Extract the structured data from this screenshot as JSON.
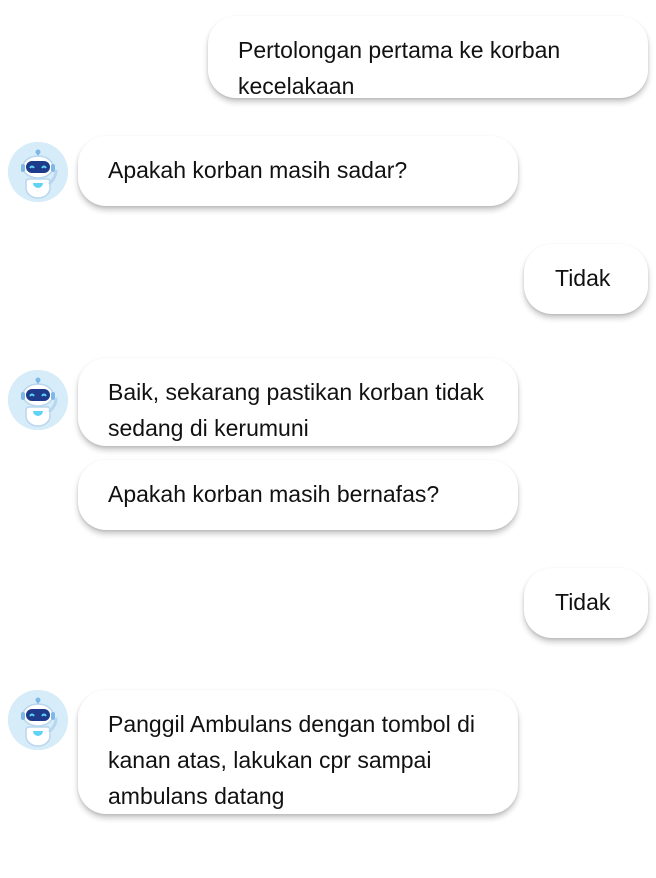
{
  "messages": [
    {
      "sender": "user",
      "text": "Pertolongan pertama ke korban kecelakaan"
    },
    {
      "sender": "bot",
      "text": "Apakah korban masih sadar?"
    },
    {
      "sender": "user",
      "text": "Tidak"
    },
    {
      "sender": "bot",
      "text": "Baik, sekarang pastikan korban tidak sedang di kerumuni"
    },
    {
      "sender": "bot",
      "text": "Apakah korban masih bernafas?"
    },
    {
      "sender": "user",
      "text": "Tidak"
    },
    {
      "sender": "bot",
      "text": "Panggil Ambulans dengan tombol di kanan atas, lakukan cpr sampai ambulans datang"
    }
  ],
  "avatar_icon": "robot-icon",
  "colors": {
    "bubble_bg": "#ffffff",
    "avatar_bg": "#d6ecf8",
    "robot_visor": "#1e3a8a",
    "robot_eyes": "#5fd3f5"
  }
}
